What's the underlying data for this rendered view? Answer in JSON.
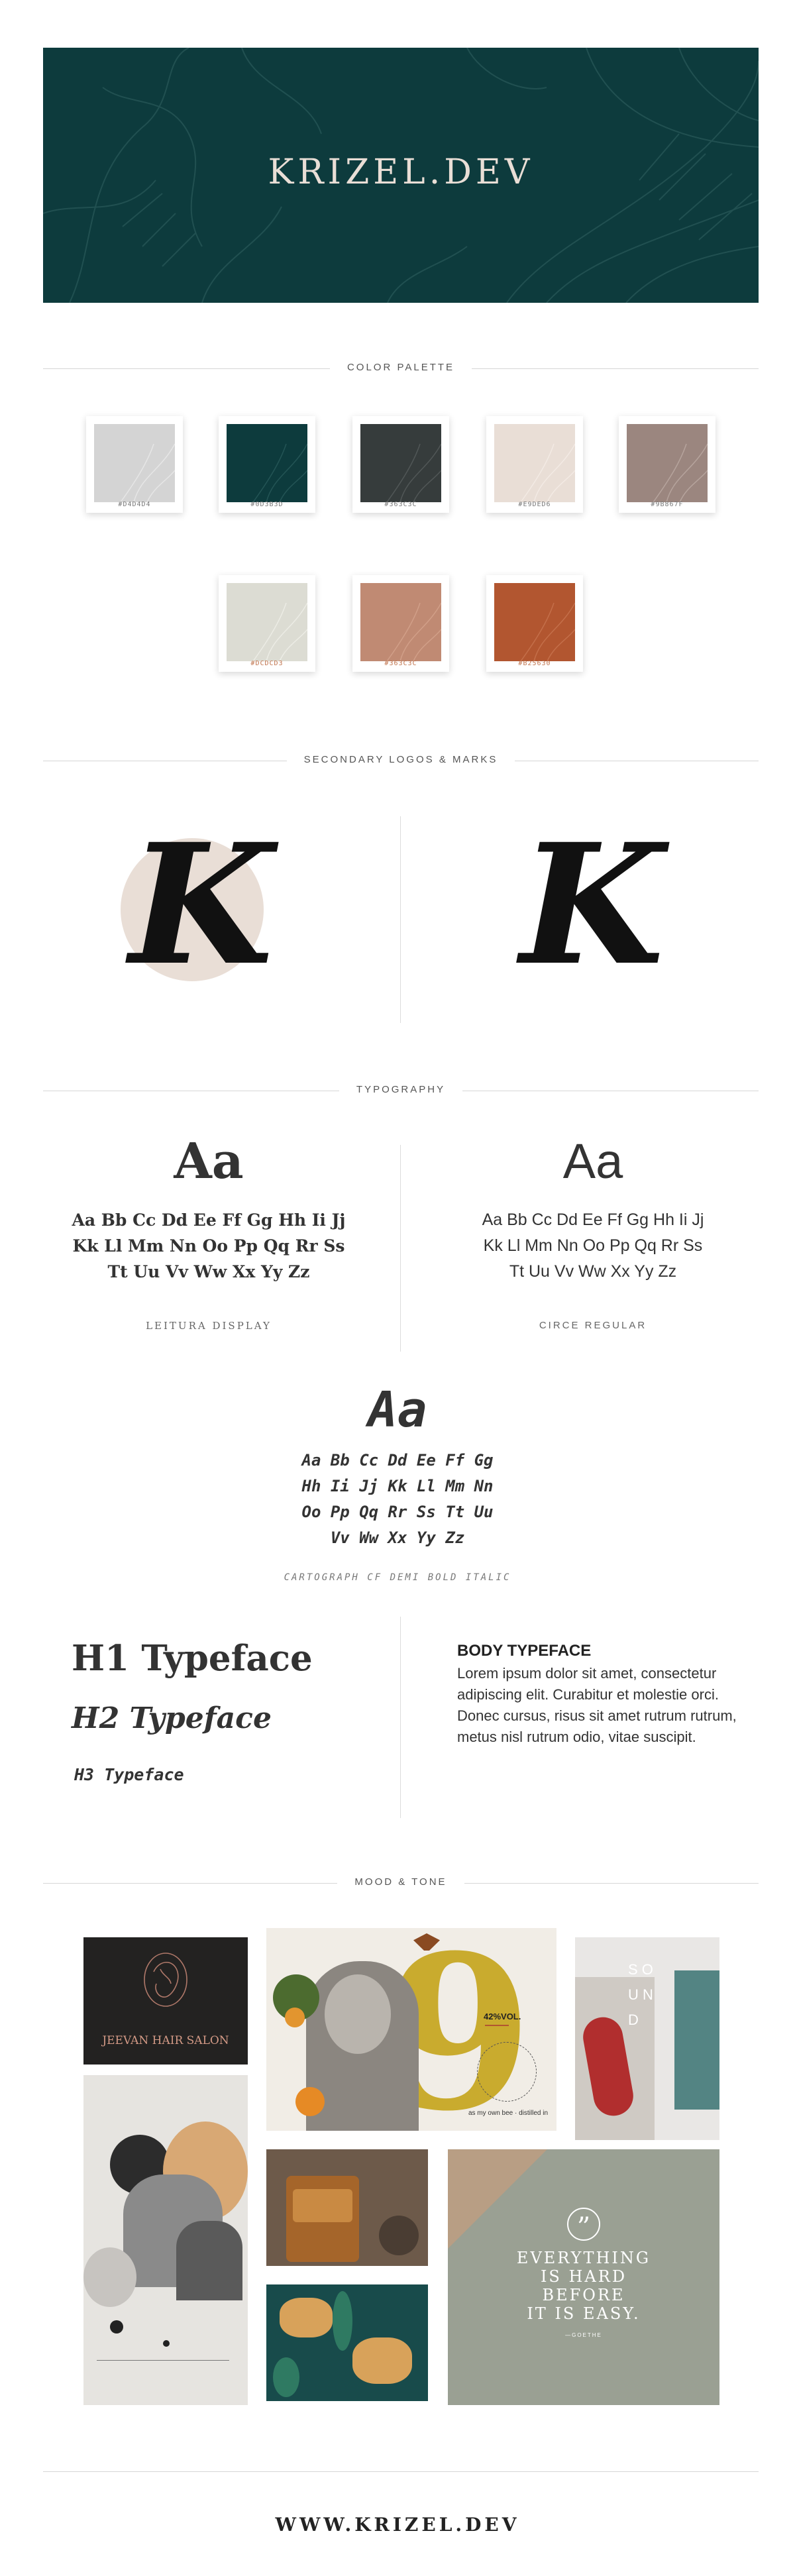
{
  "header": {
    "title": "KRIZEL.DEV",
    "bg_color": "#0d3b3d",
    "title_color": "#e9ded6"
  },
  "sections": {
    "color_palette": "COLOR PALETTE",
    "secondary_logos": "SECONDARY LOGOS & MARKS",
    "typography": "TYPOGRAPHY",
    "mood_tone": "MOOD & TONE"
  },
  "palette": [
    {
      "hex": "#D4D4D4",
      "color": "#d4d4d4"
    },
    {
      "hex": "#0D3B3D",
      "color": "#0d3b3d"
    },
    {
      "hex": "#363C3C",
      "color": "#363c3c"
    },
    {
      "hex": "#E9DED6",
      "color": "#e9ded6"
    },
    {
      "hex": "#9B867F",
      "color": "#9b867f"
    },
    {
      "hex": "#DCDCD3",
      "color": "#dcdcd3"
    },
    {
      "hex": "#363C3C",
      "color": "#c08a73"
    },
    {
      "hex": "#B25630",
      "color": "#b25630"
    }
  ],
  "logos": {
    "mark_letter": "K",
    "circle_color": "#e9ded6"
  },
  "typography": {
    "display": {
      "sample": "Aa",
      "alphabet": "Aa Bb Cc Dd Ee Ff Gg Hh Ii Jj\nKk Ll Mm Nn Oo Pp Qq Rr Ss\nTt Uu Vv Ww Xx Yy Zz",
      "name": "LEITURA DISPLAY"
    },
    "regular": {
      "sample": "Aa",
      "alphabet": "Aa Bb Cc Dd Ee Ff Gg Hh Ii Jj\nKk Ll Mm Nn Oo Pp Qq Rr Ss\nTt Uu Vv Ww Xx Yy Zz",
      "name": "CIRCE REGULAR"
    },
    "mono": {
      "sample": "Aa",
      "alphabet": "Aa Bb Cc Dd Ee Ff Gg\nHh Ii Jj Kk Ll Mm Nn\nOo Pp Qq Rr Ss Tt Uu\nVv Ww Xx Yy Zz",
      "name": "CARTOGRAPH CF DEMI BOLD ITALIC"
    },
    "headings": {
      "h1": "H1 Typeface",
      "h2": "H2 Typeface",
      "h3": "H3 Typeface"
    },
    "body": {
      "title": "BODY TYPEFACE",
      "text": "Lorem ipsum dolor sit amet, consectetur adipiscing elit. Curabitur et molestie orci. Donec cursus, risus sit amet rutrum rutrum, metus nisl rutrum odio, vitae suscipit."
    }
  },
  "mood": {
    "salon_name": "JEEVAN HAIR SALON",
    "vol_label": "42%VOL.",
    "circle_text": "as my own bee · distilled in",
    "sound_text": "S O U N D",
    "quote_mark": "”",
    "quote_lines": [
      "EVERYTHING",
      "IS HARD",
      "BEFORE",
      "IT IS EASY."
    ],
    "quote_author": "—GOETHE"
  },
  "footer": {
    "url": "WWW.KRIZEL.DEV"
  }
}
